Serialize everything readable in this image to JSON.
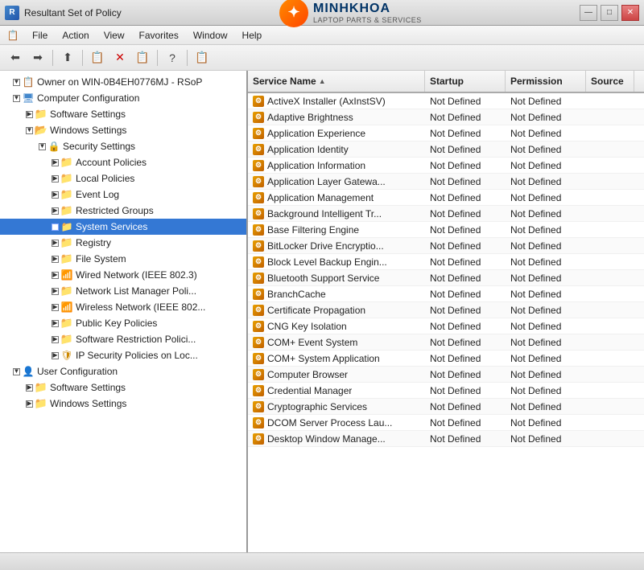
{
  "window": {
    "title": "Resultant Set of Policy",
    "title_icon": "📋",
    "min_btn": "—",
    "max_btn": "□",
    "close_btn": "✕"
  },
  "brand": {
    "name": "MINHKHOA",
    "sub": "LAPTOP PARTS & SERVICES"
  },
  "menu": {
    "items": [
      "File",
      "Action",
      "View",
      "Favorites",
      "Window",
      "Help"
    ]
  },
  "toolbar": {
    "buttons": [
      "←",
      "→",
      "⬆",
      "📋",
      "✕",
      "📋",
      "?",
      "📋"
    ]
  },
  "tree": {
    "root_label": "Owner on WIN-0B4EH0776MJ - RSoP",
    "nodes": [
      {
        "id": "computer-config",
        "label": "Computer Configuration",
        "level": 1,
        "expanded": true,
        "icon": "computer"
      },
      {
        "id": "software-settings",
        "label": "Software Settings",
        "level": 2,
        "expanded": false,
        "icon": "folder"
      },
      {
        "id": "windows-settings",
        "label": "Windows Settings",
        "level": 2,
        "expanded": true,
        "icon": "folder"
      },
      {
        "id": "security-settings",
        "label": "Security Settings",
        "level": 3,
        "expanded": true,
        "icon": "security"
      },
      {
        "id": "account-policies",
        "label": "Account Policies",
        "level": 4,
        "expanded": false,
        "icon": "folder"
      },
      {
        "id": "local-policies",
        "label": "Local Policies",
        "level": 4,
        "expanded": false,
        "icon": "folder"
      },
      {
        "id": "event-log",
        "label": "Event Log",
        "level": 4,
        "expanded": false,
        "icon": "folder"
      },
      {
        "id": "restricted-groups",
        "label": "Restricted Groups",
        "level": 4,
        "expanded": false,
        "icon": "folder"
      },
      {
        "id": "system-services",
        "label": "System Services",
        "level": 4,
        "expanded": false,
        "icon": "folder",
        "selected": true
      },
      {
        "id": "registry",
        "label": "Registry",
        "level": 4,
        "expanded": false,
        "icon": "folder"
      },
      {
        "id": "file-system",
        "label": "File System",
        "level": 4,
        "expanded": false,
        "icon": "folder"
      },
      {
        "id": "wired-network",
        "label": "Wired Network (IEEE 802.3)",
        "level": 4,
        "expanded": false,
        "icon": "network"
      },
      {
        "id": "network-list",
        "label": "Network List Manager Poli...",
        "level": 4,
        "expanded": false,
        "icon": "folder"
      },
      {
        "id": "wireless-network",
        "label": "Wireless Network (IEEE 802...",
        "level": 4,
        "expanded": false,
        "icon": "network"
      },
      {
        "id": "public-key",
        "label": "Public Key Policies",
        "level": 4,
        "expanded": false,
        "icon": "key"
      },
      {
        "id": "software-restriction",
        "label": "Software Restriction Polici...",
        "level": 4,
        "expanded": false,
        "icon": "folder"
      },
      {
        "id": "ip-security",
        "label": "IP Security Policies on Loc...",
        "level": 4,
        "expanded": false,
        "icon": "shield"
      },
      {
        "id": "user-config",
        "label": "User Configuration",
        "level": 1,
        "expanded": true,
        "icon": "user"
      },
      {
        "id": "user-software",
        "label": "Software Settings",
        "level": 2,
        "expanded": false,
        "icon": "folder"
      },
      {
        "id": "user-windows",
        "label": "Windows Settings",
        "level": 2,
        "expanded": false,
        "icon": "folder"
      }
    ]
  },
  "table": {
    "columns": [
      {
        "id": "service",
        "label": "Service Name",
        "sort": "asc"
      },
      {
        "id": "startup",
        "label": "Startup"
      },
      {
        "id": "permission",
        "label": "Permission"
      },
      {
        "id": "source",
        "label": "Source"
      }
    ],
    "rows": [
      {
        "service": "ActiveX Installer (AxInstSV)",
        "startup": "Not Defined",
        "permission": "Not Defined",
        "source": ""
      },
      {
        "service": "Adaptive Brightness",
        "startup": "Not Defined",
        "permission": "Not Defined",
        "source": ""
      },
      {
        "service": "Application Experience",
        "startup": "Not Defined",
        "permission": "Not Defined",
        "source": ""
      },
      {
        "service": "Application Identity",
        "startup": "Not Defined",
        "permission": "Not Defined",
        "source": ""
      },
      {
        "service": "Application Information",
        "startup": "Not Defined",
        "permission": "Not Defined",
        "source": ""
      },
      {
        "service": "Application Layer Gatewa...",
        "startup": "Not Defined",
        "permission": "Not Defined",
        "source": ""
      },
      {
        "service": "Application Management",
        "startup": "Not Defined",
        "permission": "Not Defined",
        "source": ""
      },
      {
        "service": "Background Intelligent Tr...",
        "startup": "Not Defined",
        "permission": "Not Defined",
        "source": ""
      },
      {
        "service": "Base Filtering Engine",
        "startup": "Not Defined",
        "permission": "Not Defined",
        "source": ""
      },
      {
        "service": "BitLocker Drive Encryptio...",
        "startup": "Not Defined",
        "permission": "Not Defined",
        "source": ""
      },
      {
        "service": "Block Level Backup Engin...",
        "startup": "Not Defined",
        "permission": "Not Defined",
        "source": ""
      },
      {
        "service": "Bluetooth Support Service",
        "startup": "Not Defined",
        "permission": "Not Defined",
        "source": ""
      },
      {
        "service": "BranchCache",
        "startup": "Not Defined",
        "permission": "Not Defined",
        "source": ""
      },
      {
        "service": "Certificate Propagation",
        "startup": "Not Defined",
        "permission": "Not Defined",
        "source": ""
      },
      {
        "service": "CNG Key Isolation",
        "startup": "Not Defined",
        "permission": "Not Defined",
        "source": ""
      },
      {
        "service": "COM+ Event System",
        "startup": "Not Defined",
        "permission": "Not Defined",
        "source": ""
      },
      {
        "service": "COM+ System Application",
        "startup": "Not Defined",
        "permission": "Not Defined",
        "source": ""
      },
      {
        "service": "Computer Browser",
        "startup": "Not Defined",
        "permission": "Not Defined",
        "source": ""
      },
      {
        "service": "Credential Manager",
        "startup": "Not Defined",
        "permission": "Not Defined",
        "source": ""
      },
      {
        "service": "Cryptographic Services",
        "startup": "Not Defined",
        "permission": "Not Defined",
        "source": ""
      },
      {
        "service": "DCOM Server Process Lau...",
        "startup": "Not Defined",
        "permission": "Not Defined",
        "source": ""
      },
      {
        "service": "Desktop Window Manage...",
        "startup": "Not Defined",
        "permission": "Not Defined",
        "source": ""
      }
    ]
  },
  "statusbar": {
    "text": ""
  }
}
